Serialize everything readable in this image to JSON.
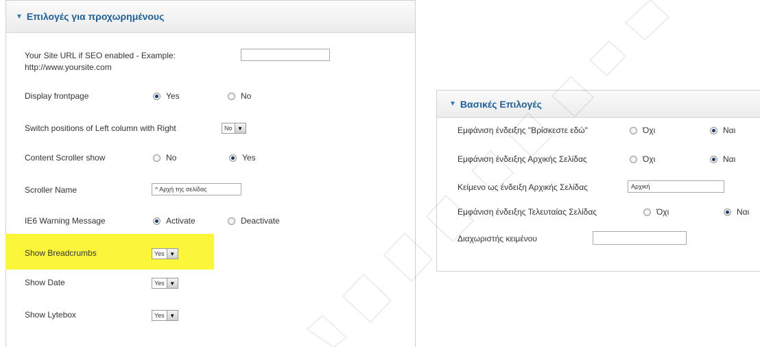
{
  "left_panel": {
    "title": "Επιλογές για προχωρημένους",
    "site_url": {
      "label_line1": "Your Site URL if SEO enabled - Example:",
      "label_line2": "http://www.yoursite.com",
      "value": ""
    },
    "display_frontpage": {
      "label": "Display frontpage",
      "opt1": "Yes",
      "opt2": "No",
      "selected": "Yes"
    },
    "switch_positions": {
      "label": "Switch positions of Left column with Right",
      "value": "No"
    },
    "content_scroller": {
      "label": "Content Scroller show",
      "opt1": "No",
      "opt2": "Yes",
      "selected": "Yes"
    },
    "scroller_name": {
      "label": "Scroller Name",
      "value": "^ Αρχή της σελίδας"
    },
    "ie6_warning": {
      "label": "IE6 Warning Message",
      "opt1": "Activate",
      "opt2": "Deactivate",
      "selected": "Activate"
    },
    "show_breadcrumbs": {
      "label": "Show Breadcrumbs",
      "value": "Yes"
    },
    "show_date": {
      "label": "Show Date",
      "value": "Yes"
    },
    "show_lytebox": {
      "label": "Show Lytebox",
      "value": "Yes"
    }
  },
  "right_panel": {
    "title": "Βασικές Επιλογές",
    "you_are_here": {
      "label": "Εμφάνιση ένδειξης \"Βρίσκεστε εδώ\"",
      "opt1": "Όχι",
      "opt2": "Ναι",
      "selected": "Ναι"
    },
    "home_indicator": {
      "label": "Εμφάνιση ένδειξης Αρχικής Σελίδας",
      "opt1": "Όχι",
      "opt2": "Ναι",
      "selected": "Ναι"
    },
    "home_text": {
      "label": "Κείμενο ως ένδειξη Αρχικής Σελίδας",
      "value": "Αρχική"
    },
    "last_page": {
      "label": "Εμφάνιση ένδειξης Τελευταίας Σελίδας",
      "opt1": "Όχι",
      "opt2": "Ναι",
      "selected": "Ναι"
    },
    "separator": {
      "label": "Διαχωριστής κειμένου",
      "value": ""
    }
  },
  "colors": {
    "header_text": "#1d5f9a",
    "highlight": "#fbf63a"
  },
  "icons": {
    "panel_toggle": "triangle-down-icon",
    "dropdown": "chevron-down-icon"
  }
}
